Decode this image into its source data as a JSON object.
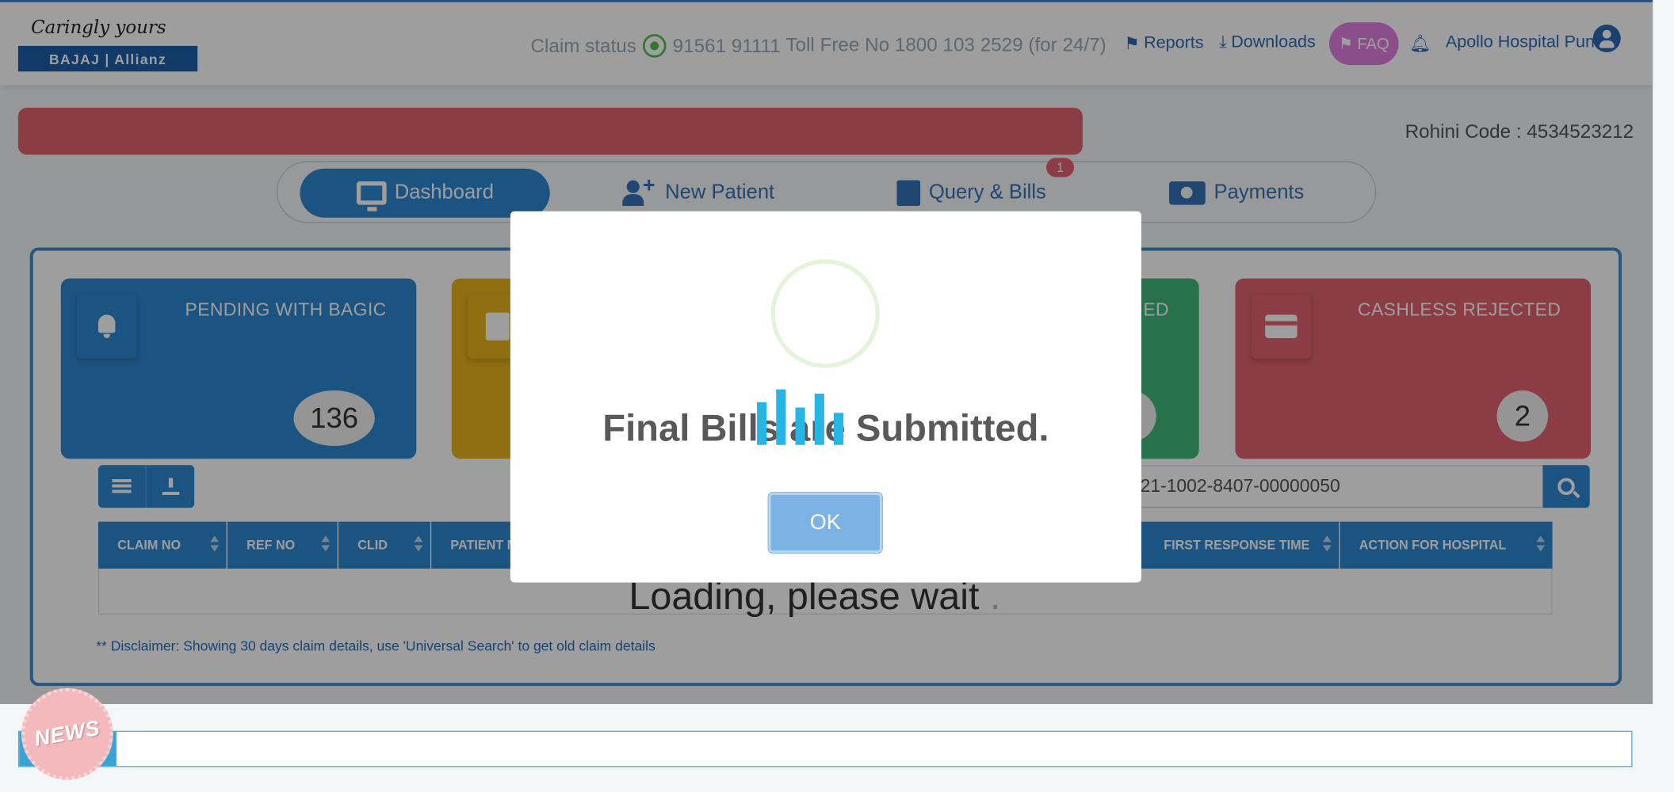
{
  "header": {
    "logo_tagline": "Caringly yours",
    "logo_brand": "BAJAJ | Allianz",
    "claim_status_label": "Claim status",
    "whatsapp_number": "91561 91111",
    "toll_free": "Toll Free No 1800 103 2529 (for 24/7)",
    "reports": "Reports",
    "downloads": "Downloads",
    "faq": "FAQ",
    "user_name": "Apollo Hospital Pune"
  },
  "rohini_code": "Rohini Code : 4534523212",
  "tabs": [
    {
      "label": "Dashboard",
      "icon": "monitor-icon",
      "active": true
    },
    {
      "label": "New Patient",
      "icon": "user-plus-icon"
    },
    {
      "label": "Query & Bills",
      "icon": "note-icon",
      "badge": "1"
    },
    {
      "label": "Payments",
      "icon": "money-icon"
    }
  ],
  "stats": [
    {
      "label": "PENDING WITH BAGIC",
      "count": "136",
      "color": "#2d87d0"
    },
    {
      "label": "",
      "count": "",
      "color": "#e8b31e"
    },
    {
      "label": "ED",
      "count": "",
      "color": "#3fb679"
    },
    {
      "label": "CASHLESS REJECTED",
      "count": "2",
      "color": "#e2616f"
    }
  ],
  "search": {
    "value": "21-1002-8407-00000050"
  },
  "table": {
    "columns": [
      "CLAIM NO",
      "REF NO",
      "CLID",
      "PATIENT N",
      "FIRST RESPONSE TIME",
      "ACTION FOR HOSPITAL"
    ],
    "loading_text": "Loading, please wait",
    "loading_dot": "."
  },
  "disclaimer": "** Disclaimer: Showing 30 days claim details, use 'Universal Search' to get old claim details",
  "news_label": "NEWS",
  "modal": {
    "title": "Final Bills are Submitted.",
    "ok_label": "OK"
  },
  "colors": {
    "primary": "#2d87d0",
    "danger": "#e2616f",
    "warning": "#e8b31e",
    "success": "#3fb679",
    "faq": "#e27fe0"
  }
}
